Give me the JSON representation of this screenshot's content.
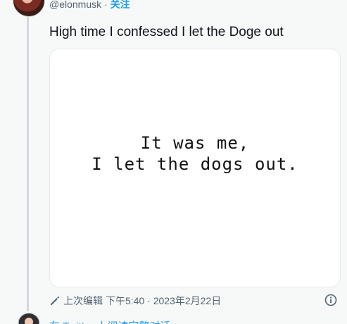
{
  "tweet": {
    "handle": "@elonmusk",
    "separator": "·",
    "follow_label": "关注",
    "text": "High time I confessed I let the Doge out",
    "image": {
      "line1": "It was me,",
      "line2": "I let the dogs out."
    },
    "footer": {
      "edit_label": "上次编辑",
      "timestamp": "下午5:40 · 2023年2月22日"
    }
  },
  "below": {
    "link_text": "在 Twitter 上阅读完整对话"
  },
  "colors": {
    "background": "#f7f9f9",
    "link": "#1d9bf0",
    "text": "#0f1419",
    "muted": "#536471"
  }
}
